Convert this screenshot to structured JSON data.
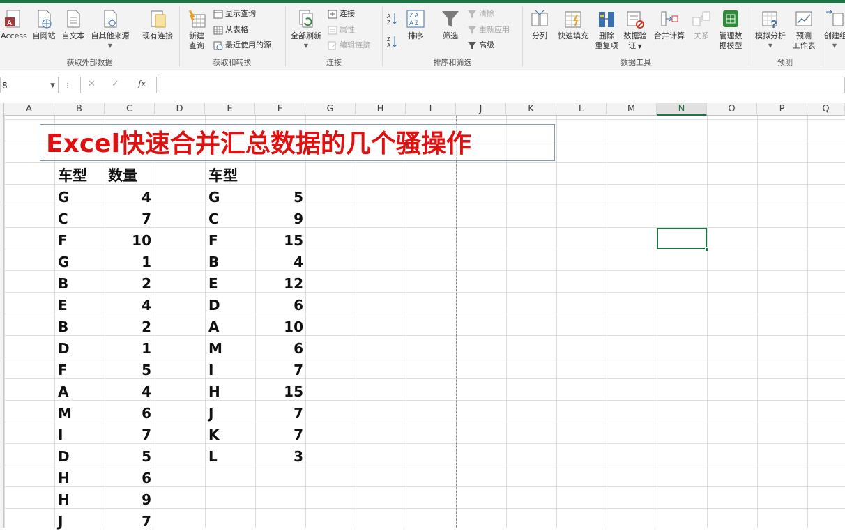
{
  "ribbon": {
    "groups": [
      {
        "label": "获取外部数据"
      },
      {
        "label": "获取和转换"
      },
      {
        "label": "连接"
      },
      {
        "label": "排序和筛选"
      },
      {
        "label": "数据工具"
      },
      {
        "label": "预测"
      }
    ],
    "buttons": {
      "access": "Access",
      "from_web": "自网站",
      "from_text": "自文本",
      "from_other": "自其他来源",
      "existing_conn": "现有连接",
      "new_query_1": "新建",
      "new_query_2": "查询",
      "show_queries": "显示查询",
      "from_table": "从表格",
      "recent_sources": "最近使用的源",
      "refresh_all": "全部刷新",
      "connections": "连接",
      "properties": "属性",
      "edit_links": "编辑链接",
      "sort": "排序",
      "filter": "筛选",
      "clear": "清除",
      "reapply": "重新应用",
      "advanced": "高级",
      "text_to_columns": "分列",
      "flash_fill": "快速填充",
      "remove_dup_1": "删除",
      "remove_dup_2": "重复项",
      "validation_1": "数据验",
      "validation_2": "证",
      "consolidate": "合并计算",
      "relationships": "关系",
      "data_model_1": "管理数",
      "data_model_2": "据模型",
      "what_if": "模拟分析",
      "forecast_1": "预测",
      "forecast_2": "工作表",
      "create_group": "创建组"
    }
  },
  "formula_bar": {
    "name_box": "8",
    "fx": "fx",
    "formula": ""
  },
  "columns": [
    "A",
    "B",
    "C",
    "D",
    "E",
    "F",
    "G",
    "H",
    "I",
    "J",
    "K",
    "L",
    "M",
    "N",
    "O",
    "P",
    "Q"
  ],
  "selected_column": "N",
  "sheet": {
    "title": "Excel快速合并汇总数据的几个骚操作",
    "table1": {
      "header_type": "车型",
      "header_qty": "数量",
      "rows": [
        {
          "type": "G",
          "qty": "4"
        },
        {
          "type": "C",
          "qty": "7"
        },
        {
          "type": "F",
          "qty": "10"
        },
        {
          "type": "G",
          "qty": "1"
        },
        {
          "type": "B",
          "qty": "2"
        },
        {
          "type": "E",
          "qty": "4"
        },
        {
          "type": "B",
          "qty": "2"
        },
        {
          "type": "D",
          "qty": "1"
        },
        {
          "type": "F",
          "qty": "5"
        },
        {
          "type": "A",
          "qty": "4"
        },
        {
          "type": "M",
          "qty": "6"
        },
        {
          "type": "I",
          "qty": "7"
        },
        {
          "type": "D",
          "qty": "5"
        },
        {
          "type": "H",
          "qty": "6"
        },
        {
          "type": "H",
          "qty": "9"
        },
        {
          "type": "J",
          "qty": "7"
        }
      ]
    },
    "table2": {
      "header_type": "车型",
      "rows": [
        {
          "type": "G",
          "qty": "5"
        },
        {
          "type": "C",
          "qty": "9"
        },
        {
          "type": "F",
          "qty": "15"
        },
        {
          "type": "B",
          "qty": "4"
        },
        {
          "type": "E",
          "qty": "12"
        },
        {
          "type": "D",
          "qty": "6"
        },
        {
          "type": "A",
          "qty": "10"
        },
        {
          "type": "M",
          "qty": "6"
        },
        {
          "type": "I",
          "qty": "7"
        },
        {
          "type": "H",
          "qty": "15"
        },
        {
          "type": "J",
          "qty": "7"
        },
        {
          "type": "K",
          "qty": "7"
        },
        {
          "type": "L",
          "qty": "3"
        }
      ]
    }
  },
  "colors": {
    "accent": "#217346",
    "title": "#e01010"
  }
}
